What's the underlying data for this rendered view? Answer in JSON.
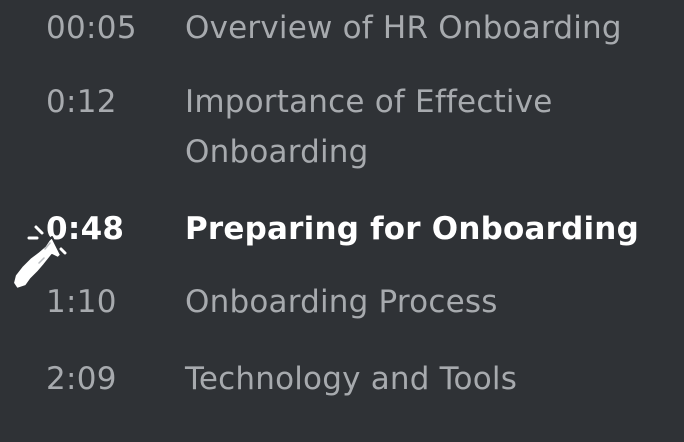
{
  "chapters": [
    {
      "time": "00:05",
      "title": "Overview of HR Onboarding",
      "active": false
    },
    {
      "time": "0:12",
      "title": "Importance of Effective Onboarding",
      "active": false
    },
    {
      "time": "0:48",
      "title": "Preparing for Onboarding",
      "active": true
    },
    {
      "time": "1:10",
      "title": "Onboarding Process",
      "active": false
    },
    {
      "time": "2:09",
      "title": "Technology and Tools",
      "active": false
    }
  ],
  "colors": {
    "background": "#2f3236",
    "inactive_text": "#a7aaae",
    "active_text": "#ffffff"
  },
  "cursor": {
    "icon": "pointer-hand-cursor-icon"
  }
}
